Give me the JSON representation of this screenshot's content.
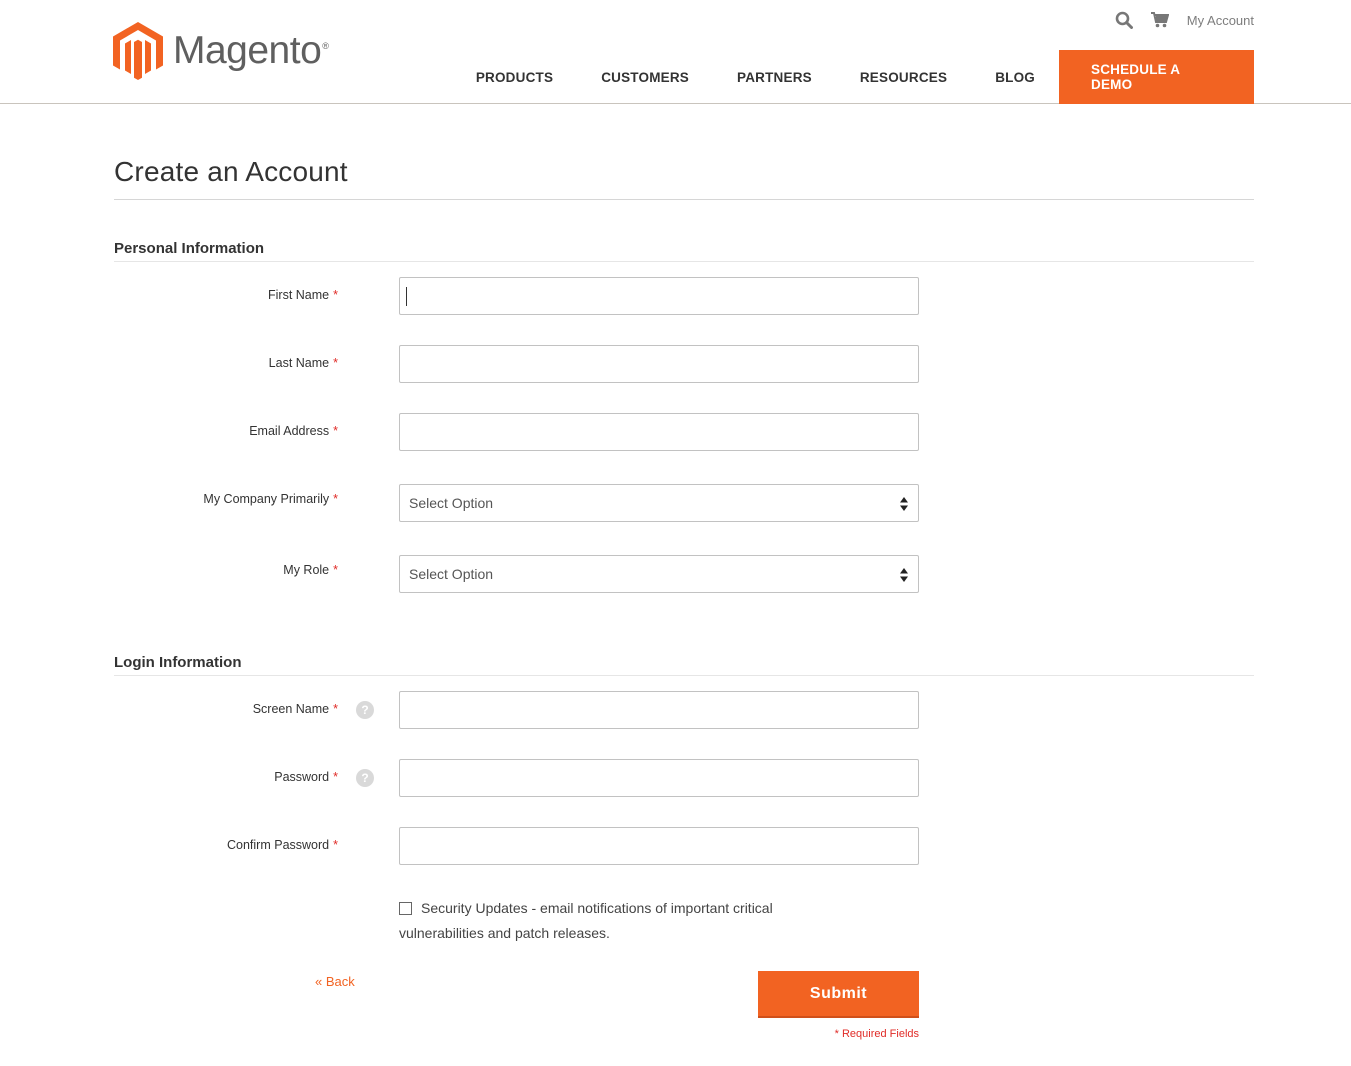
{
  "header": {
    "logo_text": "Magento",
    "logo_reg": "®",
    "utility": {
      "search_icon": "search-icon",
      "cart_icon": "cart-icon",
      "my_account": "My Account"
    },
    "nav": [
      "PRODUCTS",
      "CUSTOMERS",
      "PARTNERS",
      "RESOURCES",
      "BLOG"
    ],
    "cta": "SCHEDULE A DEMO"
  },
  "page": {
    "title": "Create an Account"
  },
  "personal": {
    "section_title": "Personal Information",
    "first_name_label": "First Name",
    "last_name_label": "Last Name",
    "email_label": "Email Address",
    "company_label": "My Company Primarily",
    "company_value": "Select Option",
    "role_label": "My Role",
    "role_value": "Select Option"
  },
  "login": {
    "section_title": "Login Information",
    "screen_name_label": "Screen Name",
    "password_label": "Password",
    "confirm_label": "Confirm Password",
    "help_glyph": "?"
  },
  "required_mark": "*",
  "checkbox": {
    "label": "Security Updates - email notifications of important critical vulnerabilities and patch releases.",
    "checked": false
  },
  "actions": {
    "back": "« Back",
    "submit": "Submit",
    "required_note": "* Required Fields"
  },
  "colors": {
    "accent": "#f26322",
    "required": "#e02b27"
  }
}
